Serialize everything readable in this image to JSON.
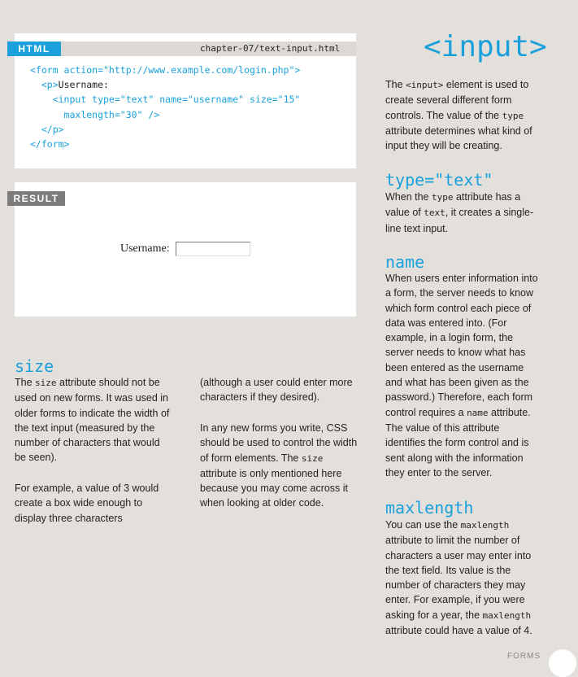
{
  "code_panel": {
    "tab_label": "HTML",
    "filename": "chapter-07/text-input.html",
    "lines": {
      "l1": "<form action=\"http://www.example.com/login.php\">",
      "l2_open": "<p>",
      "l2_text": "Username:",
      "l3": "<input type=\"text\" name=\"username\" size=\"15\"",
      "l4": "maxlength=\"30\" />",
      "l5": "</p>",
      "l6": "</form>"
    }
  },
  "result_panel": {
    "tab_label": "RESULT",
    "field_label": "Username:"
  },
  "sidebar": {
    "title": "<input>",
    "intro": {
      "a": "The ",
      "c1": "<input>",
      "b": " element is used to create several different form controls. The value of the ",
      "c2": "type",
      "c": " attribute determines what kind of input they will be creating."
    },
    "type_text": {
      "heading": "type=\"text\"",
      "a": "When the ",
      "c1": "type",
      "b": " attribute has a value of ",
      "c2": "text",
      "c": ", it creates a single-line text input."
    },
    "name": {
      "heading": "name",
      "a": "When users enter information into a form, the server needs to know which form control each piece of data was entered into. (For example, in a login form, the server needs to know what has been entered as the username and what has been given as the password.) Therefore, each form control requires a ",
      "c1": "name",
      "b": " attribute. The value of this attribute identifies the form control and is sent along with the information they enter to the server."
    },
    "maxlength": {
      "heading": "maxlength",
      "a": "You can use the ",
      "c1": "maxlength",
      "b": " attribute to limit the number of characters a user may enter into the text field. Its value is the number of characters they may enter. For example, if you were asking for a year, the ",
      "c2": "maxlength",
      "c": " attribute could have a value of 4."
    }
  },
  "size": {
    "heading": "size",
    "col1_p1": {
      "a": "The ",
      "c1": "size",
      "b": " attribute should not be used on new forms. It was used in older forms to indicate the width of the text input (measured by the number of characters that would be seen)."
    },
    "col1_p2": "For example, a value of 3 would create a box wide enough to display three characters",
    "col2_p1": "(although a user could enter more characters if they desired).",
    "col2_p2": {
      "a": "In any new forms you write, CSS should be used to control the width of form elements. The ",
      "c1": "size",
      "b": " attribute is only mentioned here because you may come across it when looking at older code."
    }
  },
  "footer": {
    "page_word": "FORMS"
  }
}
